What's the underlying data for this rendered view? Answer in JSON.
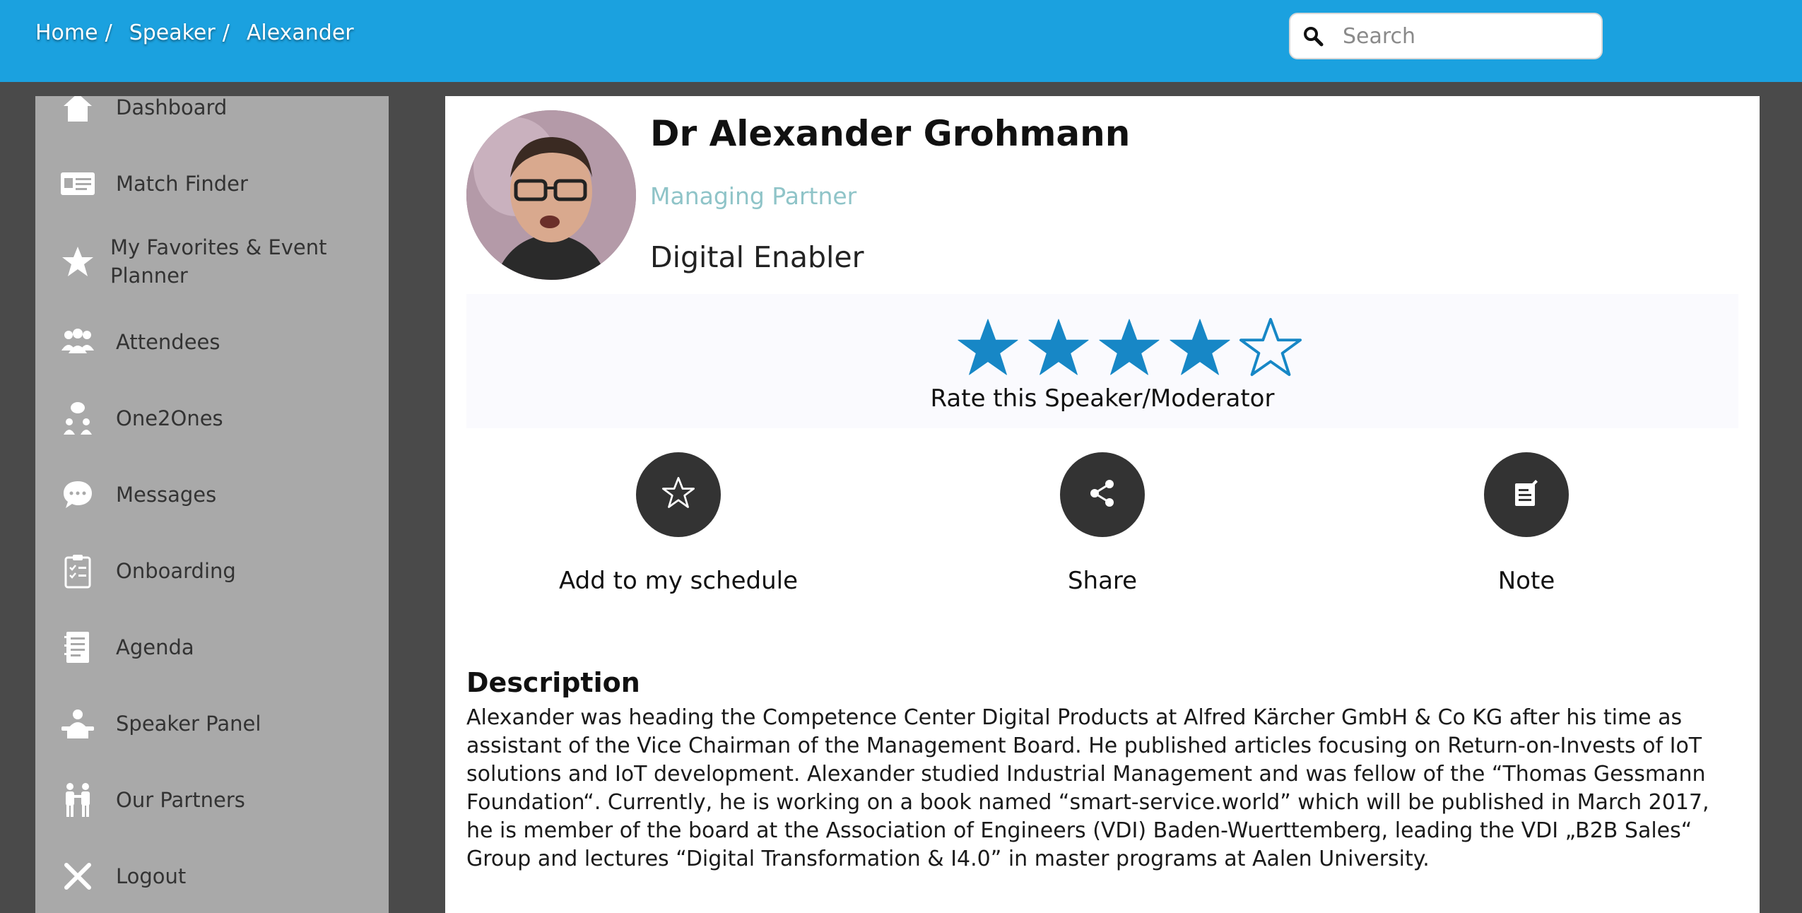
{
  "breadcrumb": {
    "home": "Home",
    "speaker": "Speaker",
    "current": "Alexander",
    "separator": "/"
  },
  "search": {
    "placeholder": "Search",
    "icon": "search-icon"
  },
  "sidebar": {
    "items": [
      {
        "label": "Dashboard",
        "icon": "home-icon"
      },
      {
        "label": "Match Finder",
        "icon": "id-card-icon"
      },
      {
        "label": "My Favorites & Event Planner",
        "icon": "star-icon"
      },
      {
        "label": "Attendees",
        "icon": "people-icon"
      },
      {
        "label": "One2Ones",
        "icon": "meeting-icon"
      },
      {
        "label": "Messages",
        "icon": "chat-icon"
      },
      {
        "label": "Onboarding",
        "icon": "clipboard-icon"
      },
      {
        "label": "Agenda",
        "icon": "agenda-icon"
      },
      {
        "label": "Speaker Panel",
        "icon": "speaker-icon"
      },
      {
        "label": "Our Partners",
        "icon": "handshake-icon"
      },
      {
        "label": "Logout",
        "icon": "close-icon"
      }
    ]
  },
  "speaker": {
    "name": "Dr Alexander Grohmann",
    "role": "Managing Partner",
    "company": "Digital Enabler"
  },
  "rating": {
    "value": 4,
    "max": 5,
    "label": "Rate this Speaker/Moderator",
    "color": "#1787c6"
  },
  "actions": {
    "schedule": "Add to my schedule",
    "share": "Share",
    "note": "Note"
  },
  "description": {
    "title": "Description",
    "text": "Alexander was heading the Competence Center Digital Products at Alfred Kärcher GmbH & Co KG after his time as assistant of the Vice Chairman of the Management Board. He published articles focusing on Return-on-Invests of IoT solutions and IoT development. Alexander studied Industrial Management and was fellow of the “Thomas Gessmann Foundation“. Currently, he is working on a book named “smart-service.world” which will be published in March 2017, he is member of the board at the Association of Engineers (VDI) Baden-Wuerttemberg, leading the VDI „B2B Sales“ Group and lectures “Digital Transformation & I4.0” in master programs at Aalen University."
  },
  "colors": {
    "topbar": "#1ba1df",
    "sidebar": "#a9a9a9",
    "background": "#4a4a4a"
  }
}
